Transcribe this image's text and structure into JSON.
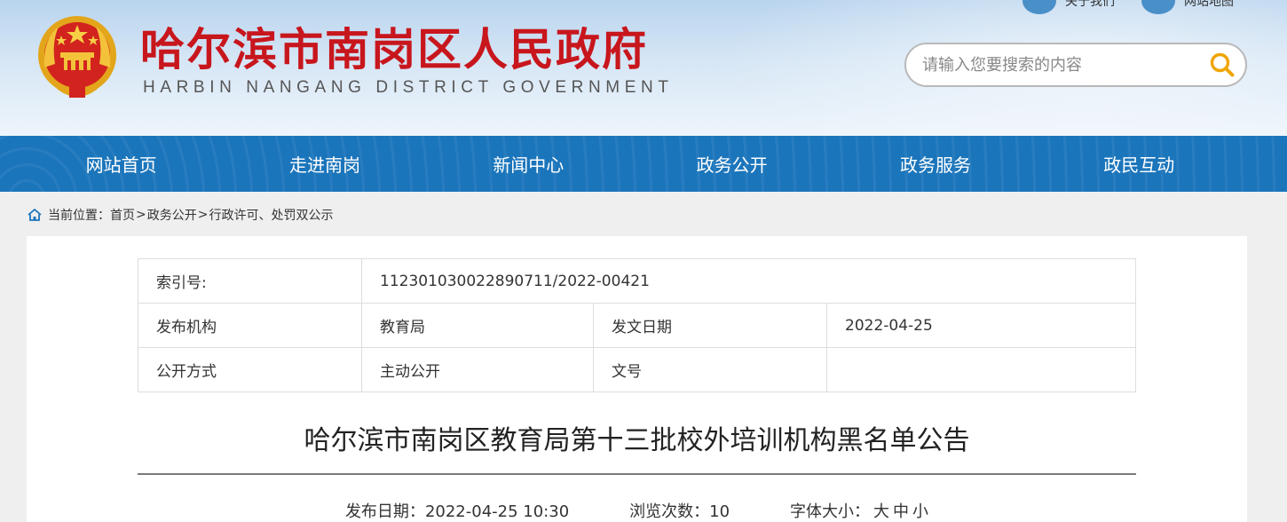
{
  "header": {
    "title": "哈尔滨市南岗区人民政府",
    "subtitle": "HARBIN NANGANG DISTRICT GOVERNMENT",
    "top_links": [
      {
        "label": "关于我们"
      },
      {
        "label": "网站地图"
      }
    ],
    "search": {
      "placeholder": "请输入您要搜索的内容",
      "value": ""
    },
    "colors": {
      "title": "#c8161d",
      "nav": "#1b75bb"
    }
  },
  "nav": {
    "items": [
      {
        "label": "网站首页"
      },
      {
        "label": "走进南岗"
      },
      {
        "label": "新闻中心"
      },
      {
        "label": "政务公开"
      },
      {
        "label": "政务服务"
      },
      {
        "label": "政民互动"
      }
    ]
  },
  "breadcrumb": {
    "prefix": "当前位置：",
    "items": [
      "首页",
      "政务公开",
      "行政许可、处罚双公示"
    ],
    "sep": ">"
  },
  "meta_table": {
    "index_label": "索引号:",
    "index_value": "112301030022890711/2022-00421",
    "org_label": "发布机构",
    "org_value": "教育局",
    "date_label": "发文日期",
    "date_value": "2022-04-25",
    "method_label": "公开方式",
    "method_value": "主动公开",
    "docno_label": "文号",
    "docno_value": ""
  },
  "article": {
    "title": "哈尔滨市南岗区教育局第十三批校外培训机构黑名单公告",
    "publish_label": "发布日期：",
    "publish_value": "2022-04-25 10:30",
    "views_label": "浏览次数：",
    "views_value": "10",
    "fontsize_label": "字体大小：",
    "fontsize_options": [
      "大",
      "中",
      "小"
    ]
  }
}
